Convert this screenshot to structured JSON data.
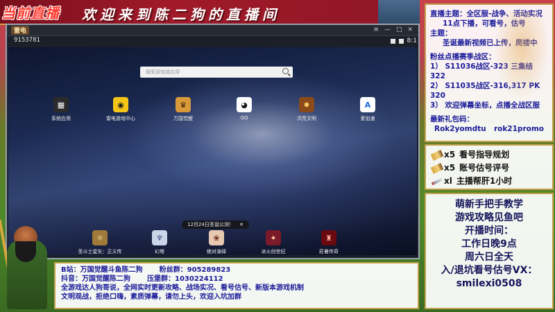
{
  "banner": {
    "live_tag": "当前直播",
    "welcome": "欢迎来到陈二狗的直播间"
  },
  "emulator": {
    "logo": "雷电",
    "device_id": "9153781",
    "clock": "8:1",
    "search_placeholder": "搜索游戏或应用",
    "apps_top": [
      {
        "label": "系统应用",
        "icon": "system-apps-icon",
        "glyph": "▦",
        "bg": "#2b2b2b",
        "fg": "#ffffff"
      },
      {
        "label": "雷电游戏中心",
        "icon": "game-center-icon",
        "glyph": "◉",
        "bg": "#f5c518",
        "fg": "#1a1a1a"
      },
      {
        "label": "万国觉醒",
        "icon": "rok-app-icon",
        "glyph": "♛",
        "bg": "#d99a3a",
        "fg": "#3a1a00"
      },
      {
        "label": "QQ",
        "icon": "qq-icon",
        "glyph": "◕",
        "bg": "#ffffff",
        "fg": "#1a1a1a"
      },
      {
        "label": "洪荒文明",
        "icon": "honghuang-app-icon",
        "glyph": "✹",
        "bg": "#8a4a1a",
        "fg": "#ffcc66"
      },
      {
        "label": "爱加速",
        "icon": "aijiasu-icon",
        "glyph": "A",
        "bg": "#ffffff",
        "fg": "#1a6ad9"
      }
    ],
    "apps_bottom": [
      {
        "label": "圣斗士星矢：正义传说",
        "icon": "saint-seiya-app-icon",
        "glyph": "☼",
        "bg": "#a07a3a",
        "fg": "#fff1c0"
      },
      {
        "label": "幻塔",
        "icon": "huanta-app-icon",
        "glyph": "♆",
        "bg": "#c9d6ea",
        "fg": "#3a4a7a"
      },
      {
        "label": "绝对演绎",
        "icon": "juedui-app-icon",
        "glyph": "❀",
        "bg": "#e6c9b0",
        "fg": "#6a2a1a"
      },
      {
        "label": "冰火创世纪",
        "icon": "binghuo-app-icon",
        "glyph": "✦",
        "bg": "#7a1a2a",
        "fg": "#ffd0a0"
      },
      {
        "label": "莊暑传奇",
        "icon": "zhuangshu-app-icon",
        "glyph": "♜",
        "bg": "#6a0a10",
        "fg": "#ffb0a0"
      }
    ],
    "toast": "12月24日圣诞公测！"
  },
  "panel_info": {
    "topic_label": "直播主题：",
    "topic_value": "全区服-战争、活动实况",
    "topic_line2": "11点下播，可看号，估号",
    "theme_label": "主题：",
    "theme_value": "圣诞最新视频已上传，爬楼中",
    "fan_title": "粉丝点播赛季战区：",
    "fan_items": [
      "1） S11036战区-323 三集结 322",
      "2） S11035战区-316,317 PK 320",
      "3） 欢迎弹幕坐标，点播全战区服"
    ],
    "gift_label": "最新礼包码：",
    "gift_codes": [
      "Rok2yomdtu",
      "rok21promo"
    ]
  },
  "panel_rewards": {
    "items": [
      {
        "icon": "pencil-icon",
        "count": "x5",
        "text": "看号指导规划"
      },
      {
        "icon": "pencil-icon",
        "count": "x5",
        "text": "账号估号评号"
      },
      {
        "icon": "sword-icon",
        "count": "xl",
        "text": "主播帮肝1小时"
      }
    ]
  },
  "panel_schedule": {
    "lines": [
      "萌新手把手教学",
      "游戏攻略见鱼吧",
      "开播时间：",
      "工作日晚9点",
      "周六日全天",
      "入/退坑看号估号VX：",
      "smilexi0508"
    ]
  },
  "bottom_panel": {
    "line1_a": "B站：万国觉醒斗鱼陈二狗",
    "line1_b": "粉丝群：905289823",
    "line2_a": "抖音：万国觉醒陈二狗",
    "line2_b": "压堡群：1030224112",
    "line3": "全游戏达人狗哥说，全网实时更新攻略、战场实况、看号估号、新版本游戏机制",
    "line4": "文明观战，拒绝口嗨，素质弹幕，请勿上头，欢迎入坑加群"
  }
}
